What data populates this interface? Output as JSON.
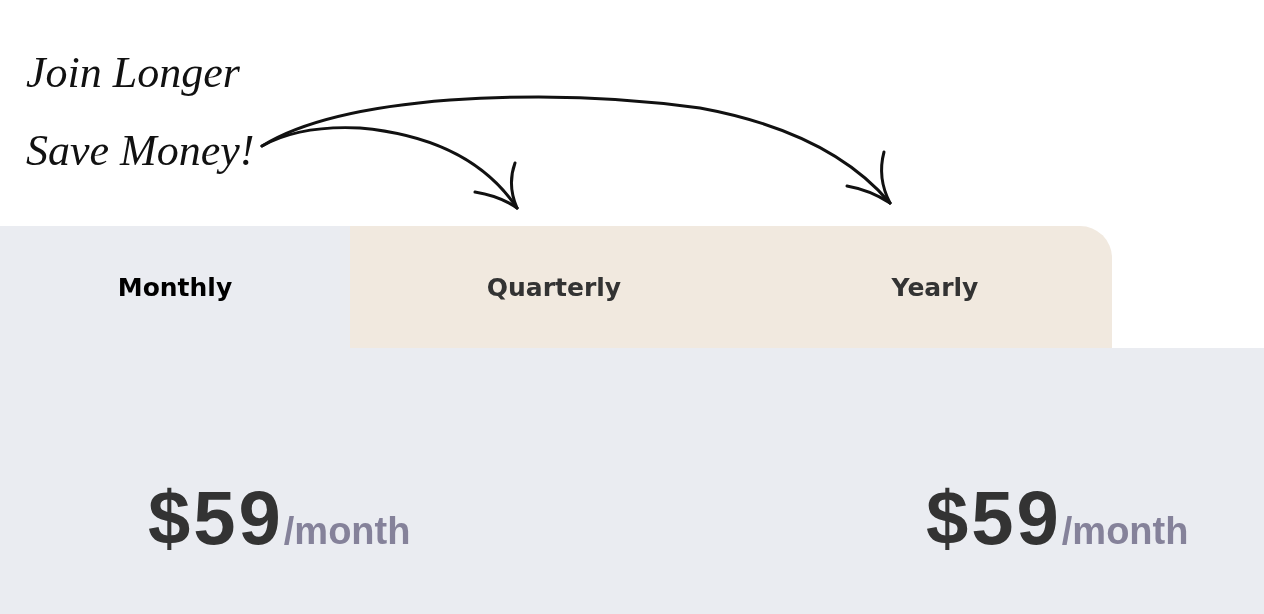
{
  "tagline": {
    "lines": [
      "Join Longer",
      "Save Money!"
    ]
  },
  "tabs": [
    {
      "label": "Monthly",
      "selected": true
    },
    {
      "label": "Quarterly",
      "selected": false
    },
    {
      "label": "Yearly",
      "selected": false
    }
  ],
  "plans": [
    {
      "price": "$59",
      "period": "/month"
    },
    {
      "price": "$59",
      "period": "/month"
    }
  ]
}
